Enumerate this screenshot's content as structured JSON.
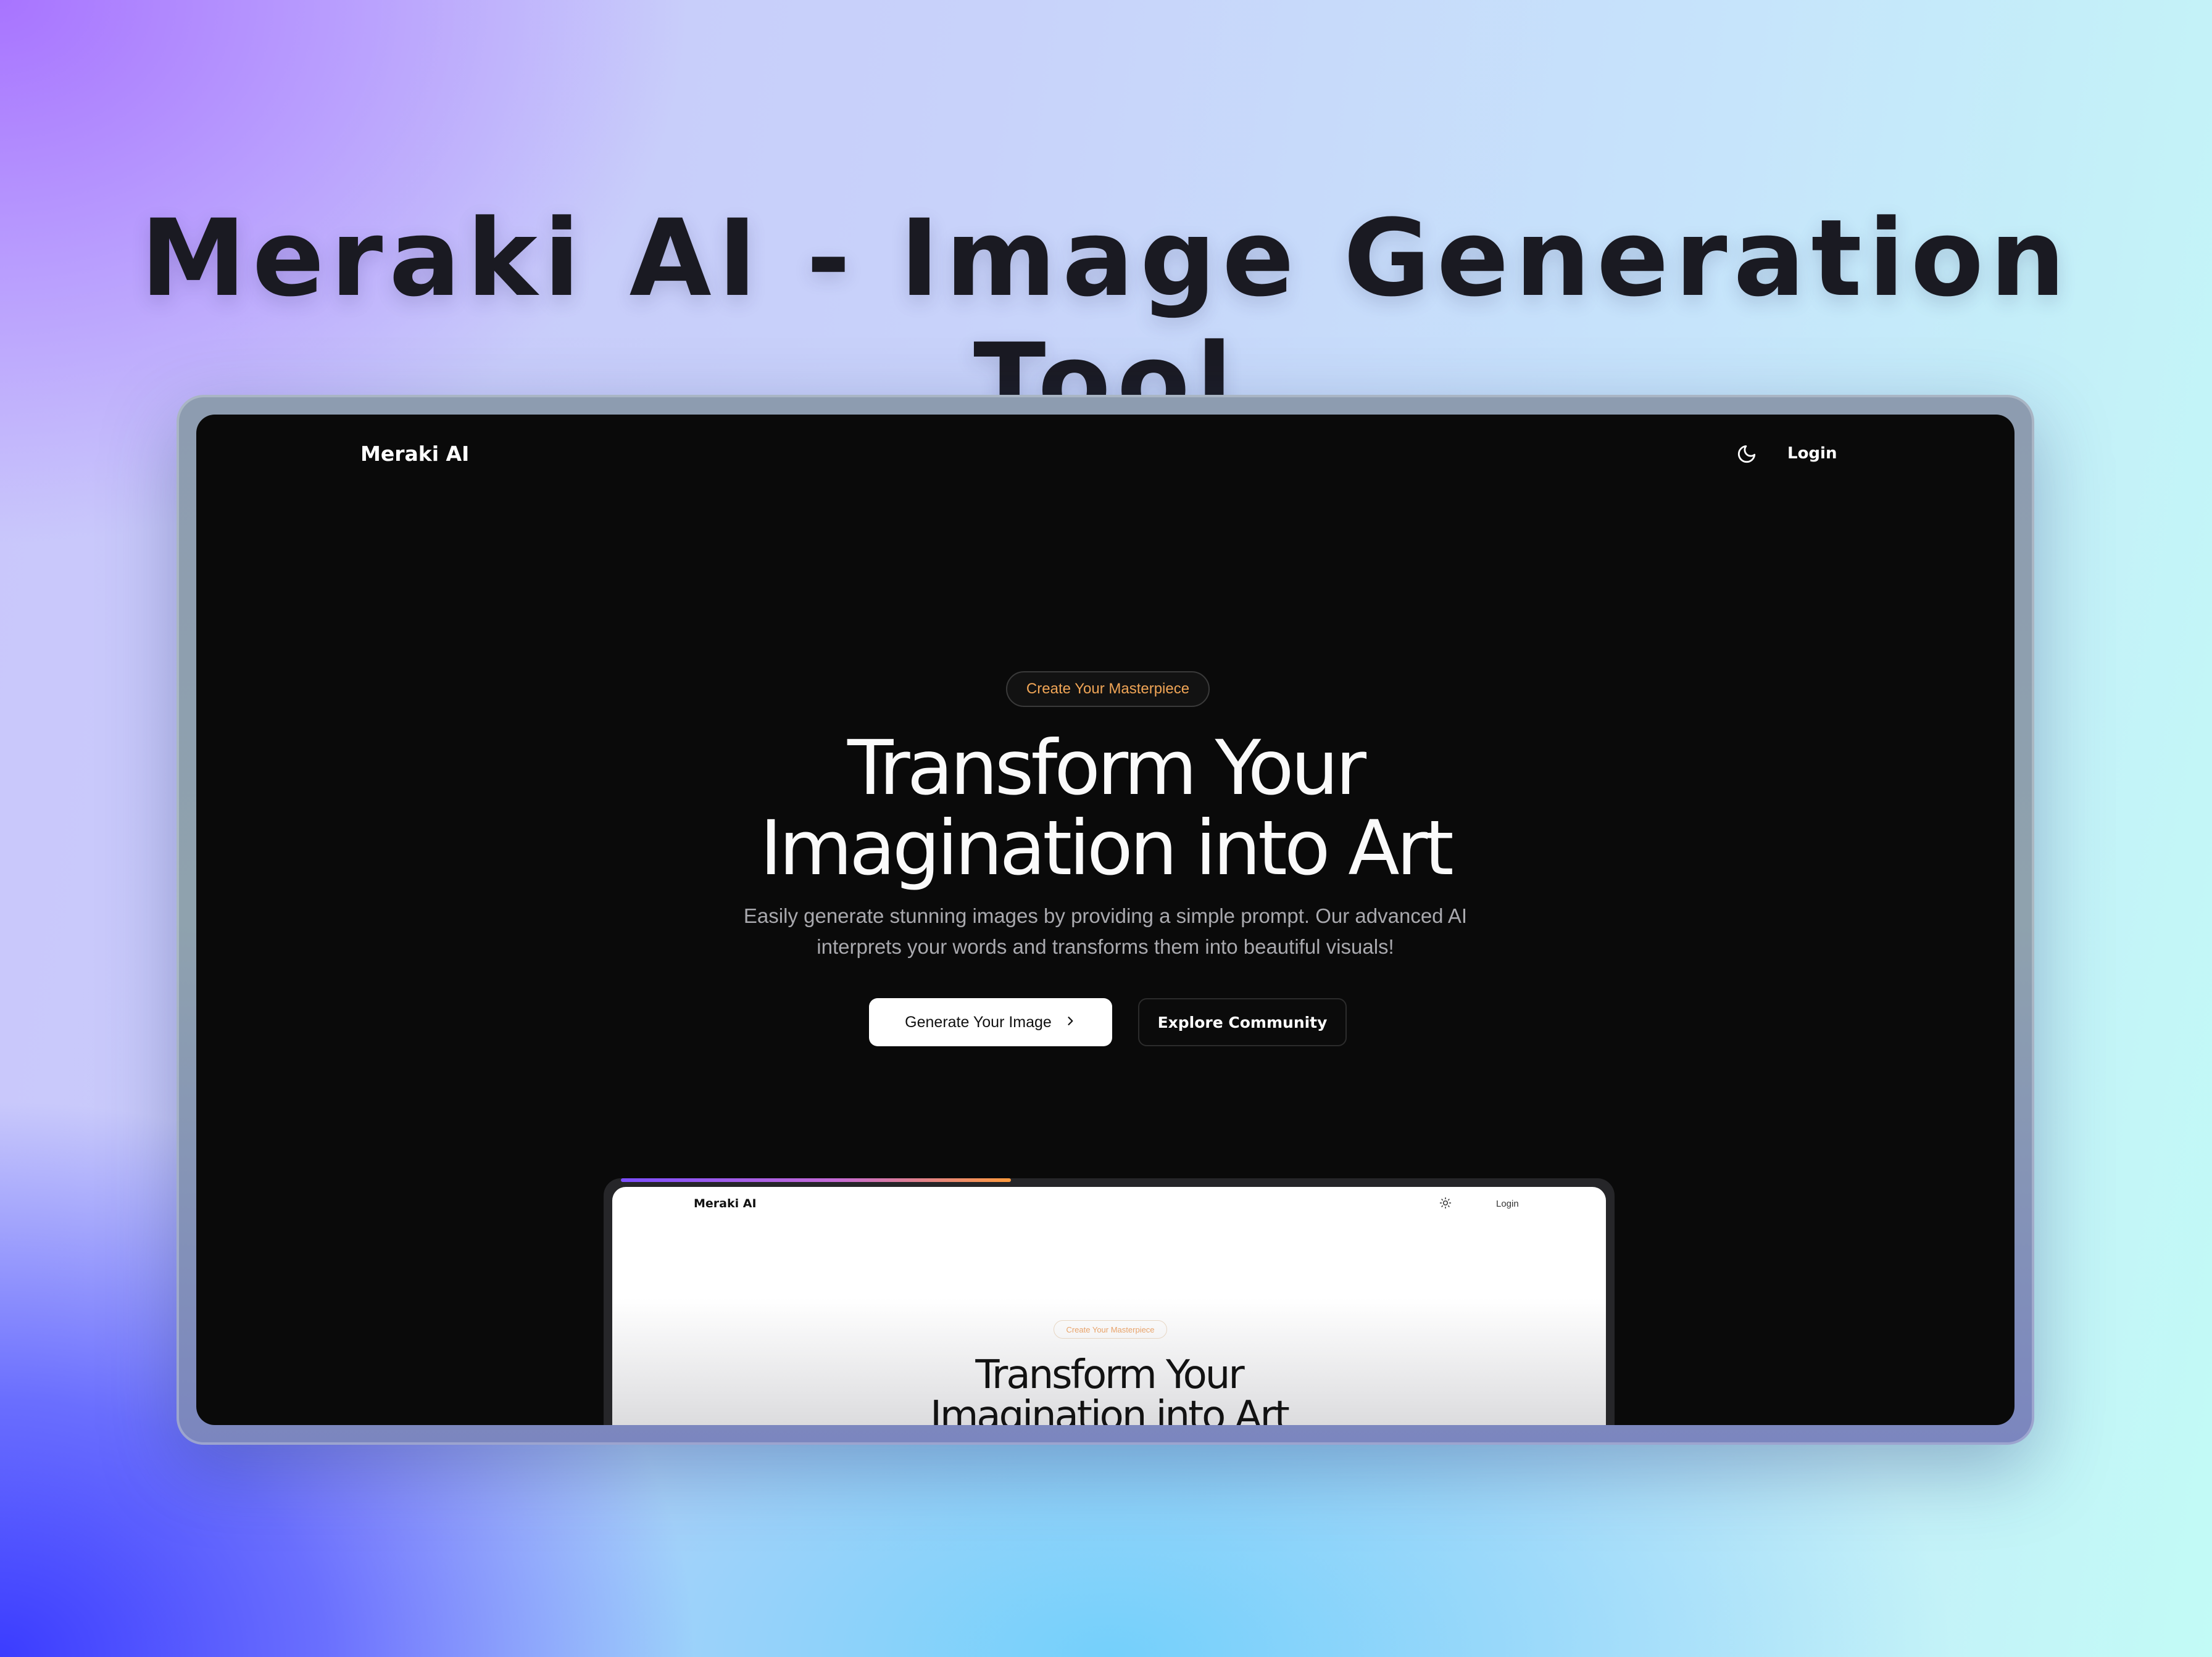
{
  "banner": {
    "title": "Meraki AI - Image Generation Tool"
  },
  "nav": {
    "brand": "Meraki AI",
    "theme_icon": "moon-icon",
    "login_label": "Login"
  },
  "hero": {
    "badge": "Create Your Masterpiece",
    "headline_line1": "Transform Your",
    "headline_line2": "Imagination into Art",
    "subtext": "Easily generate stunning images by providing a simple prompt. Our advanced AI interprets your words and transforms them into beautiful visuals!",
    "primary_button": "Generate Your Image",
    "primary_button_icon": "chevron-right-icon",
    "secondary_button": "Explore Community"
  },
  "preview": {
    "brand": "Meraki AI",
    "theme_icon": "sun-icon",
    "login_label": "Login",
    "badge": "Create Your Masterpiece",
    "headline_line1": "Transform Your",
    "headline_line2": "Imagination into Art"
  },
  "colors": {
    "screen_bg": "#0a0a0a",
    "badge_text": "#f0a556",
    "progress_gradient": [
      "#7b4dff",
      "#c56ad6",
      "#ff9a3c"
    ]
  }
}
